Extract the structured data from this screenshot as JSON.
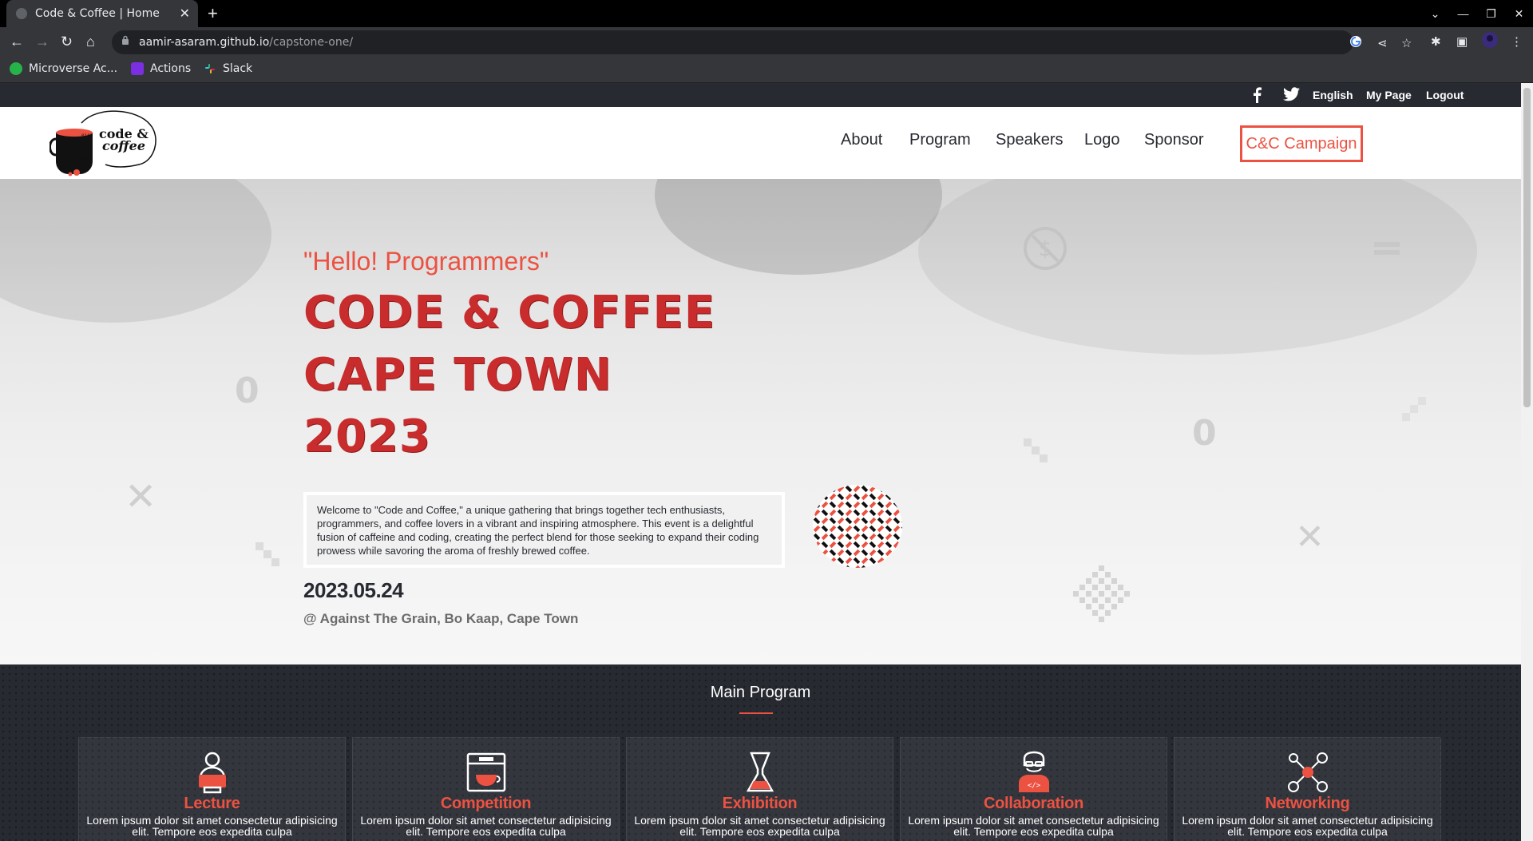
{
  "browser": {
    "tab_title": "Code & Coffee | Home",
    "new_tab": "+",
    "url_host": "aamir-asaram.github.io",
    "url_path": "/capstone-one/",
    "bookmarks": [
      "Microverse Ac...",
      "Actions",
      "Slack"
    ]
  },
  "topbar": {
    "links": [
      "English",
      "My Page",
      "Logout"
    ]
  },
  "header": {
    "logo_text_1": "code &",
    "logo_text_2": "coffee",
    "nav": [
      "About",
      "Program",
      "Speakers",
      "Logo",
      "Sponsor"
    ],
    "campaign": "C&C Campaign"
  },
  "hero": {
    "hello": "\"Hello! Programmers\"",
    "title_lines": [
      "CODE & COFFEE",
      "CAPE TOWN",
      "2023"
    ],
    "welcome": "Welcome to \"Code and Coffee,\" a unique gathering that brings together tech enthusiasts, programmers, and coffee lovers in a vibrant and inspiring atmosphere. This event is a delightful fusion of caffeine and coding, creating the perfect blend for those seeking to expand their coding prowess while savoring the aroma of freshly brewed coffee.",
    "date": "2023.05.24",
    "venue": "@ Against The Grain, Bo Kaap, Cape Town"
  },
  "program": {
    "title": "Main Program",
    "cards": [
      {
        "title": "Lecture",
        "icon": "lecture-icon",
        "desc": "Lorem ipsum dolor sit amet consectetur adipisicing elit. Tempore eos expedita culpa"
      },
      {
        "title": "Competition",
        "icon": "coffee-machine-icon",
        "desc": "Lorem ipsum dolor sit amet consectetur adipisicing elit. Tempore eos expedita culpa"
      },
      {
        "title": "Exhibition",
        "icon": "chemex-icon",
        "desc": "Lorem ipsum dolor sit amet consectetur adipisicing elit. Tempore eos expedita culpa"
      },
      {
        "title": "Collaboration",
        "icon": "developer-icon",
        "desc": "Lorem ipsum dolor sit amet consectetur adipisicing elit. Tempore eos expedita culpa"
      },
      {
        "title": "Networking",
        "icon": "network-icon",
        "desc": "Lorem ipsum dolor sit amet consectetur adipisicing elit. Tempore eos expedita culpa"
      }
    ]
  },
  "colors": {
    "accent": "#ec5242",
    "dark": "#272a31",
    "title_red": "#c92c2c"
  }
}
